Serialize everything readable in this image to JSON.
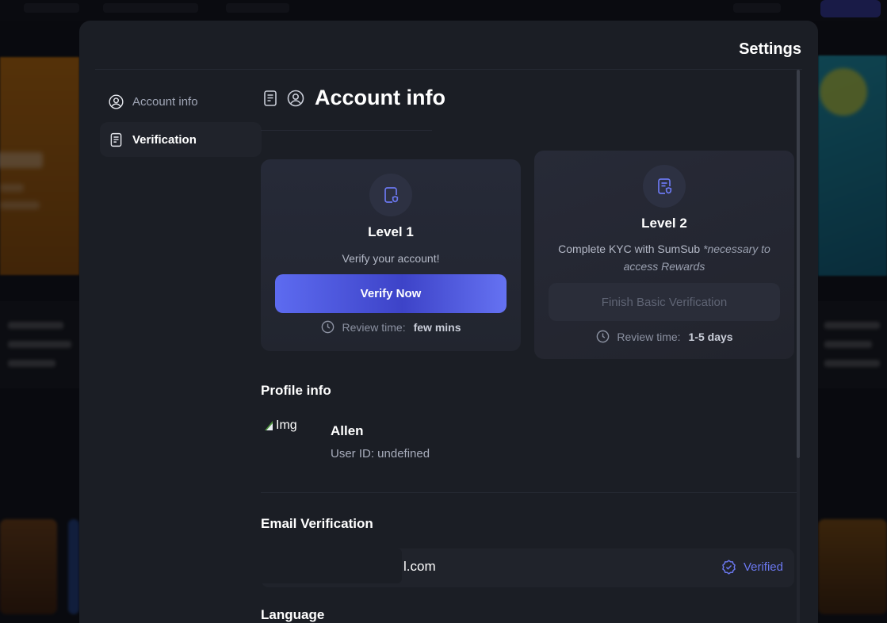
{
  "modal": {
    "title": "Settings"
  },
  "sidebar": {
    "items": [
      {
        "label": "Account info",
        "icon": "user-circle-icon",
        "active": false
      },
      {
        "label": "Verification",
        "icon": "document-icon",
        "active": true
      }
    ]
  },
  "main": {
    "heading": "Account info",
    "levels": [
      {
        "name": "Level 1",
        "description": "Verify your account!",
        "button_label": "Verify Now",
        "review_label": "Review time:",
        "review_value": "few mins",
        "icon": "file-shield-icon"
      },
      {
        "name": "Level 2",
        "description": "Complete KYC with SumSub",
        "description_note": "*necessary to access Rewards",
        "button_label": "Finish Basic Verification",
        "review_label": "Review time:",
        "review_value": "1-5 days",
        "icon": "document-shield-icon"
      }
    ],
    "profile": {
      "section_title": "Profile info",
      "avatar_alt": "Img",
      "name": "Allen",
      "user_id": "User ID: undefined"
    },
    "email": {
      "section_title": "Email Verification",
      "value_visible": "l.com",
      "status": "Verified"
    },
    "language": {
      "section_title": "Language"
    }
  },
  "colors": {
    "accent": "#5d6bf0",
    "verified": "#6b78f0",
    "modal_bg": "#1b1e25",
    "card_bg": "#262a38"
  }
}
